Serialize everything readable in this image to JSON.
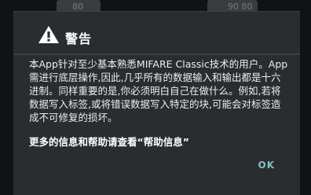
{
  "background": {
    "tile_left_text": "80",
    "tile_right_text": "90 80"
  },
  "dialog": {
    "icon": "warning-triangle-icon",
    "title": "警告",
    "body": "本App针对至少基本熟悉MIFARE Classic技术的用户。App需进行底层操作,因此,几乎所有的数据输入和输出都是十六进制。同样重要的是,你必须明白自己在做什么。例如,若将数据写入标签,或将错误数据写入特定的块,可能会对标签造成不可修复的损坏。",
    "more_info": "更多的信息和帮助请查看“帮助信息”",
    "ok_label": "OK"
  },
  "colors": {
    "dialog_bg": "#2a2d30",
    "accent": "#7fc2c8"
  }
}
